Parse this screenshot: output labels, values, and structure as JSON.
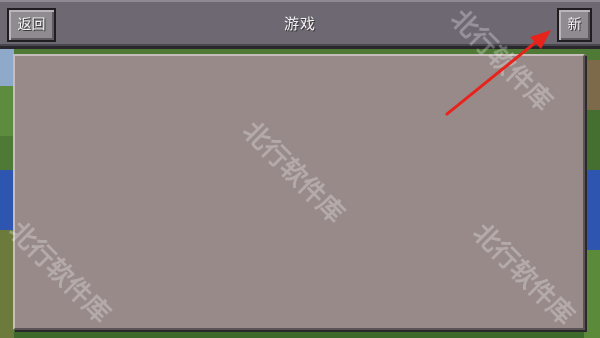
{
  "topbar": {
    "back_label": "返回",
    "title": "游戏",
    "new_label": "新"
  },
  "panel": {
    "items": []
  },
  "watermark": {
    "text": "北行软件库"
  },
  "colors": {
    "topbar": "#6e6872",
    "button": "#8f8b90",
    "panel": "#978a89",
    "arrow": "#e8231c"
  }
}
